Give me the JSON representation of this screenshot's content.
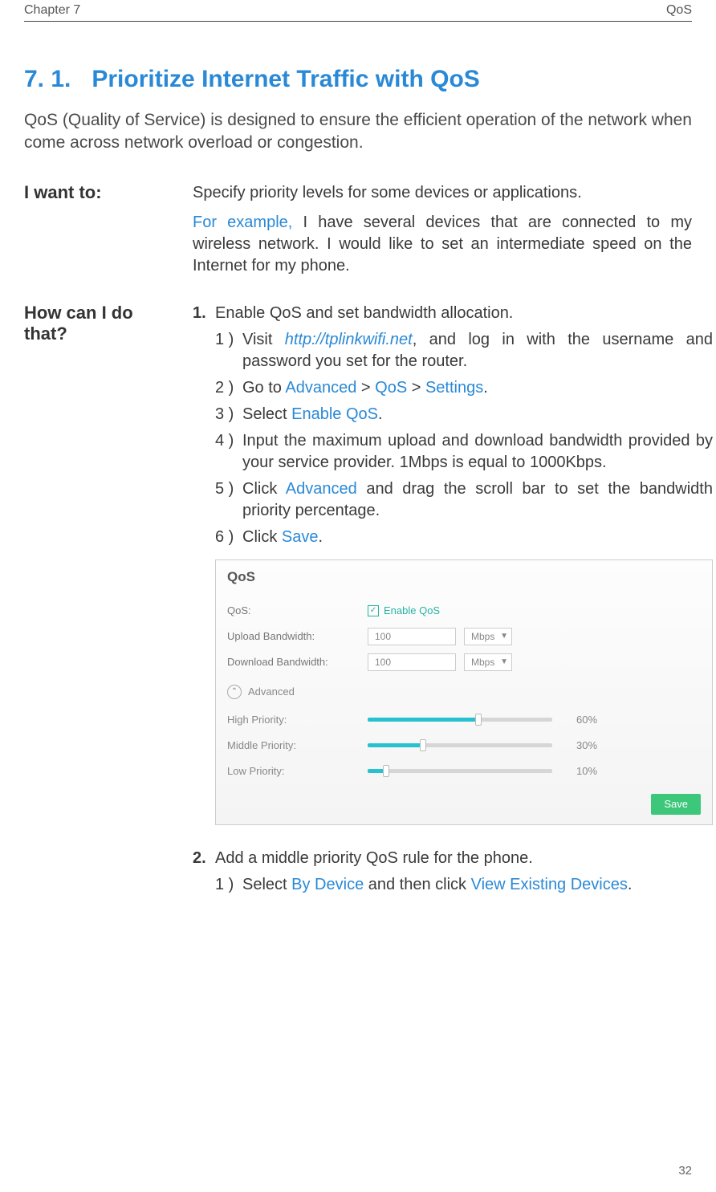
{
  "header": {
    "chapter": "Chapter 7",
    "topic": "QoS"
  },
  "section": {
    "number": "7. 1.",
    "title": "Prioritize Internet Traffic with QoS"
  },
  "intro": "QoS (Quality of Service) is designed to ensure the efficient operation of the network when come across network overload or congestion.",
  "i_want_to": {
    "label": "I want to:",
    "specify": "Specify priority levels for some devices or applications.",
    "example_label": "For example,",
    "example_text": " I have several devices that are connected to my wireless network. I would like to set an intermediate speed on the Internet for my phone."
  },
  "how_can_i": {
    "label": "How can I do that?",
    "steps": [
      {
        "num": "1.",
        "text": "Enable QoS and set bandwidth allocation.",
        "substeps": [
          {
            "num": "1 )",
            "pre": "Visit ",
            "link": "http://tplinkwifi.net",
            "post": ", and log in with the username and password you set for the router."
          },
          {
            "num": "2 )",
            "pre": "Go to ",
            "t1": "Advanced",
            "sep1": " > ",
            "t2": "QoS",
            "sep2": " > ",
            "t3": "Settings",
            "post": "."
          },
          {
            "num": "3 )",
            "pre": "Select ",
            "t1": "Enable QoS",
            "post": "."
          },
          {
            "num": "4 )",
            "text": "Input the maximum upload and download bandwidth provided by your service provider. 1Mbps is equal to 1000Kbps."
          },
          {
            "num": "5 )",
            "pre": "Click ",
            "t1": "Advanced",
            "post": " and drag the scroll bar to set the bandwidth priority percentage."
          },
          {
            "num": "6 )",
            "pre": "Click ",
            "t1": "Save",
            "post": "."
          }
        ]
      },
      {
        "num": "2.",
        "text": "Add a middle priority QoS rule for the phone.",
        "substeps": [
          {
            "num": "1 )",
            "pre": " Select ",
            "t1": "By Device",
            "mid": " and then click ",
            "t2": "View Existing Devices",
            "post": "."
          }
        ]
      }
    ]
  },
  "qos_panel": {
    "title": "QoS",
    "enable_row_label": "QoS:",
    "enable_label": "Enable QoS",
    "upload_label": "Upload Bandwidth:",
    "download_label": "Download Bandwidth:",
    "upload_value": "100",
    "download_value": "100",
    "unit": "Mbps",
    "advanced_label": "Advanced",
    "priorities": [
      {
        "label": "High Priority:",
        "pct": 60,
        "text": "60%"
      },
      {
        "label": "Middle Priority:",
        "pct": 30,
        "text": "30%"
      },
      {
        "label": "Low Priority:",
        "pct": 10,
        "text": "10%"
      }
    ],
    "save": "Save"
  },
  "footer_page": "32"
}
